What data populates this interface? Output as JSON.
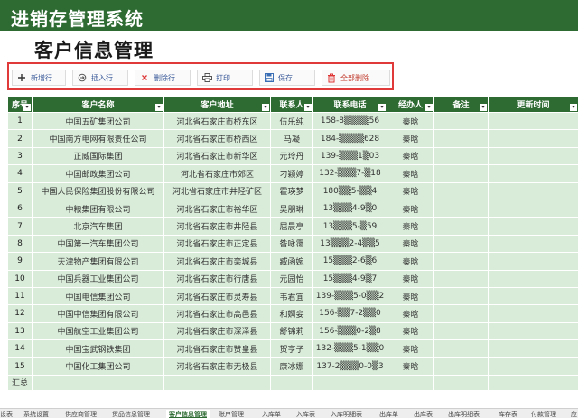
{
  "app": {
    "title": "进销存管理系统"
  },
  "page": {
    "title": "客户信息管理"
  },
  "toolbar": {
    "add_row": "新增行",
    "insert_row": "插入行",
    "delete_row": "删除行",
    "print": "打印",
    "save": "保存",
    "delete_all": "全部删除"
  },
  "table": {
    "headers": [
      "序号",
      "客户名称",
      "客户地址",
      "联系人",
      "联系电话",
      "经办人",
      "备注",
      "更新时间"
    ],
    "rows": [
      [
        "1",
        "中国五矿集团公司",
        "河北省石家庄市桥东区",
        "伍乐纯",
        "158-8▒▒▒▒56",
        "秦晗",
        "",
        ""
      ],
      [
        "2",
        "中国南方电网有限责任公司",
        "河北省石家庄市桥西区",
        "马凝",
        "184-▒▒▒▒628",
        "秦晗",
        "",
        ""
      ],
      [
        "3",
        "正威国际集团",
        "河北省石家庄市新华区",
        "元玲丹",
        "139-▒▒▒1▒03",
        "秦晗",
        "",
        ""
      ],
      [
        "4",
        "中国邮政集团公司",
        "河北省石家庄市郊区",
        "刁颖婷",
        "132-▒▒▒7-▒18",
        "秦晗",
        "",
        ""
      ],
      [
        "5",
        "中国人民保险集团股份有限公司",
        "河北省石家庄市井陉矿区",
        "霍瑛梦",
        "180▒▒5-▒▒4",
        "秦晗",
        "",
        ""
      ],
      [
        "6",
        "中粮集团有限公司",
        "河北省石家庄市裕华区",
        "吴朋琳",
        "13▒▒▒4-9▒0",
        "秦晗",
        "",
        ""
      ],
      [
        "7",
        "北京汽车集团",
        "河北省石家庄市井陉县",
        "屈晨亭",
        "13▒▒▒5-▒59",
        "秦晗",
        "",
        ""
      ],
      [
        "8",
        "中国第一汽车集团公司",
        "河北省石家庄市正定县",
        "昝咏霭",
        "13▒▒▒2-4▒▒5",
        "秦晗",
        "",
        ""
      ],
      [
        "9",
        "天津物产集团有限公司",
        "河北省石家庄市栾城县",
        "臧函婉",
        "15▒▒▒2-6▒6",
        "秦晗",
        "",
        ""
      ],
      [
        "10",
        "中国兵器工业集团公司",
        "河北省石家庄市行唐县",
        "元园怡",
        "15▒▒▒4-9▒7",
        "秦晗",
        "",
        ""
      ],
      [
        "11",
        "中国电信集团公司",
        "河北省石家庄市灵寿县",
        "韦君宜",
        "139-▒▒▒5-0▒▒2",
        "秦晗",
        "",
        ""
      ],
      [
        "12",
        "中国中信集团有限公司",
        "河北省石家庄市高邑县",
        "和婀娈",
        "156-▒▒7-2▒▒0",
        "秦晗",
        "",
        ""
      ],
      [
        "13",
        "中国航空工业集团公司",
        "河北省石家庄市深泽县",
        "舒锦莉",
        "156-▒▒▒0-2▒8",
        "秦晗",
        "",
        ""
      ],
      [
        "14",
        "中国宝武钢铁集团",
        "河北省石家庄市赞皇县",
        "贺亨子",
        "132-▒▒▒5-1▒▒0",
        "秦晗",
        "",
        ""
      ],
      [
        "15",
        "中国化工集团公司",
        "河北省石家庄市无极县",
        "康冰娜",
        "137-2▒▒▒0-0▒3",
        "秦晗",
        "",
        ""
      ]
    ],
    "summary_label": "汇总"
  },
  "sheet_tabs": {
    "items": [
      "设表",
      "系统设置",
      "供应商管理",
      "货品信息管理",
      "客户信息管理",
      "账户管理",
      "入库单",
      "入库表",
      "入库明细表",
      "出库单",
      "出库表",
      "出库明细表",
      "库存表",
      "付款管理",
      "应"
    ],
    "active": "客户信息管理"
  },
  "colors": {
    "header_green": "#2e6b33",
    "row_green": "#d9ecd9",
    "toolbar_highlight": "#e03a3a"
  }
}
